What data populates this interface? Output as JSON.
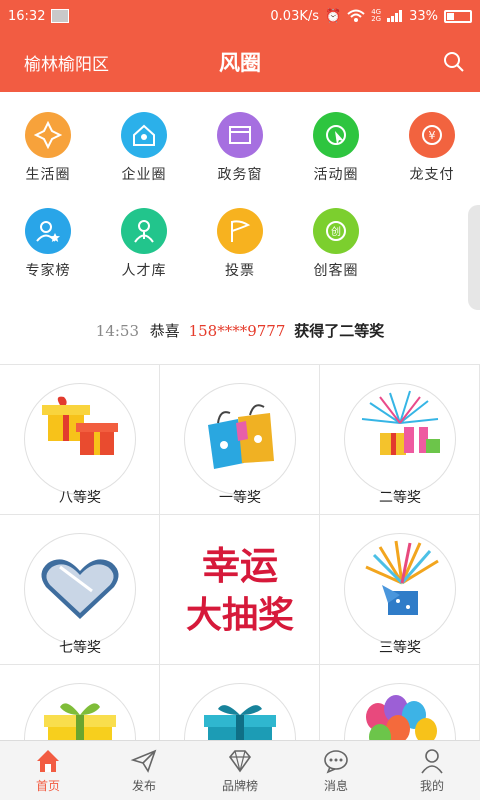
{
  "status_bar": {
    "time": "16:32",
    "speed": "0.03K/s",
    "network_4g": "4G",
    "network_2g": "2G",
    "battery": "33%"
  },
  "header": {
    "location": "榆林榆阳区",
    "title": "风圈",
    "search_icon": "search-icon"
  },
  "categories": [
    {
      "label": "生活圈",
      "icon": "life-circle-icon",
      "color": "#f7a23b"
    },
    {
      "label": "企业圈",
      "icon": "enterprise-circle-icon",
      "color": "#2bb0ea"
    },
    {
      "label": "政务窗",
      "icon": "government-window-icon",
      "color": "#a66fe0"
    },
    {
      "label": "活动圈",
      "icon": "activity-circle-icon",
      "color": "#2ec53f"
    },
    {
      "label": "龙支付",
      "icon": "long-pay-icon",
      "color": "#f2633f"
    },
    {
      "label": "专家榜",
      "icon": "expert-ranking-icon",
      "color": "#29a5e8"
    },
    {
      "label": "人才库",
      "icon": "talent-pool-icon",
      "color": "#22c58c"
    },
    {
      "label": "投票",
      "icon": "vote-icon",
      "color": "#f7b21f"
    },
    {
      "label": "创客圈",
      "icon": "maker-circle-icon",
      "color": "#7ccf2e"
    }
  ],
  "winner": {
    "time": "14:53",
    "prefix": "恭喜",
    "phone": "158****9777",
    "suffix": "获得了二等奖"
  },
  "prizes": [
    {
      "label": "八等奖",
      "art": "gift-boxes-icon"
    },
    {
      "label": "一等奖",
      "art": "shopping-bags-icon"
    },
    {
      "label": "二等奖",
      "art": "gifts-fireworks-icon"
    },
    {
      "label": "七等奖",
      "art": "heart-gift-box-icon"
    },
    {
      "label": "幸运大抽奖",
      "art": "lucky-draw-logo"
    },
    {
      "label": "三等奖",
      "art": "surprise-box-icon"
    },
    {
      "label": "",
      "art": "yellow-gift-icon"
    },
    {
      "label": "",
      "art": "teal-gift-icon"
    },
    {
      "label": "",
      "art": "balloons-icon"
    }
  ],
  "lucky_draw": {
    "line1": "幸运",
    "line2": "大抽奖"
  },
  "bottom_nav": [
    {
      "label": "首页",
      "icon": "home-icon",
      "active": true
    },
    {
      "label": "发布",
      "icon": "paper-plane-icon",
      "active": false
    },
    {
      "label": "品牌榜",
      "icon": "diamond-icon",
      "active": false
    },
    {
      "label": "消息",
      "icon": "message-icon",
      "active": false
    },
    {
      "label": "我的",
      "icon": "person-icon",
      "active": false
    }
  ],
  "colors": {
    "primary": "#f25c42",
    "highlight": "#e53b2b"
  }
}
